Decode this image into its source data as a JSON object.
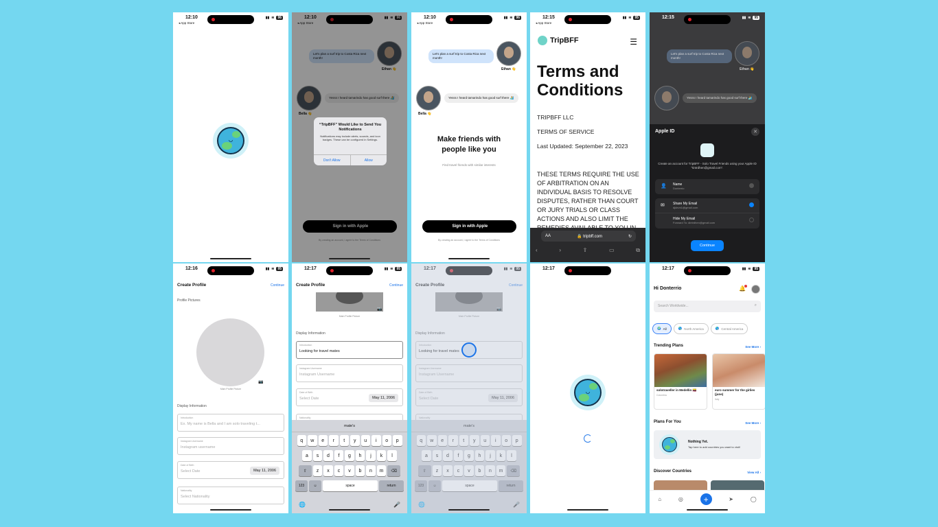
{
  "screens": {
    "splash": {
      "time": "12:10",
      "back": "◂ App Store",
      "battery": "96"
    },
    "notif": {
      "time": "12:10",
      "back": "◂ App Store",
      "battery": "96",
      "chat1": "Let's plan a surf trip to Costa Rica next month!",
      "name1": "Ethan 👋",
      "chat2": "Yesss I heard tamarindo has good surf there 🏄",
      "name2": "Bella 👋",
      "alert_title": "“TripBFF” Would Like to Send You Notifications",
      "alert_msg": "Notifications may include alerts, sounds, and icon badges. These can be configured in Settings.",
      "dont_allow": "Don't Allow",
      "allow": "Allow",
      "signin": "Sign in with Apple",
      "legal": "By creating an account, I agree to the Terms of Conditions"
    },
    "welcome": {
      "time": "12:10",
      "back": "◂ App Store",
      "battery": "96",
      "chat1": "Let's plan a surf trip to Costa Rica next month!",
      "name1": "Ethan 👋",
      "chat2": "Yesss I heard tamarindo has good surf there 🏄",
      "name2": "Bella 👋",
      "headline": "Make friends with people like you",
      "sub": "Find travel friends with similar interests",
      "signin": "Sign in with Apple",
      "legal": "By creating an account, I agree to the Terms of Conditions"
    },
    "terms": {
      "time": "12:15",
      "back": "◂ App Store",
      "battery": "95",
      "brand": "TripBFF",
      "title": "Terms and Conditions",
      "company": "TRIPBFF LLC",
      "tos": "TERMS OF SERVICE",
      "updated": "Last Updated: September 22, 2023",
      "caps": "THESE TERMS REQUIRE THE USE OF ARBITRATION ON AN INDIVIDUAL BASIS TO RESOLVE DISPUTES, RATHER THAN COURT OR JURY TRIALS OR CLASS ACTIONS AND ALSO LIMIT THE REMEDIES AVAILABLE TO YOU IN",
      "aa": "AA",
      "url": "🔒 tripbff.com",
      "reload": "↻"
    },
    "appleid": {
      "time": "12:15",
      "battery": "95",
      "chat1": "Let's plan a surf trip to Costa Rica next month!",
      "name1": "Ethan 👋",
      "chat2": "Yesss I heard tamarindo has good surf there 🏄",
      "sheet_title": "Apple ID",
      "close": "✕",
      "desc": "Create an account for TripBFF - Solo Travel Friends using your Apple ID “tintrdhen@gmail.com”.",
      "name_label": "Name",
      "name_value": "Donterrio",
      "share_label": "Share My Email",
      "share_value": "djdevn1@gmail.com",
      "hide_label": "Hide My Email",
      "hide_value": "Forward To: dintrdhen@gmail.com",
      "continue": "Continue"
    },
    "profile1": {
      "time": "12:16",
      "battery": "95",
      "title": "Create Profile",
      "continue": "Continue",
      "pics": "Profile Pictures",
      "main_pic": "Main Profile Picture",
      "display_info": "Display Information",
      "intro_label": "Introduction",
      "intro_ph": "Ex. My name is Bella and I am solo traveling t...",
      "ig_label": "Instagram Username",
      "ig_ph": "Instagram username",
      "dob_label": "Date of Birth",
      "dob_ph": "Select Date",
      "dob_val": "May 11, 2006",
      "nat_label": "Nationality",
      "nat_ph": "Select Nationality"
    },
    "profile2": {
      "time": "12:17",
      "battery": "95",
      "title": "Create Profile",
      "continue": "Continue",
      "main_pic": "Main Profile Picture",
      "display_info": "Display Information",
      "intro_label": "Introduction",
      "intro_val": "Looking for travel mates",
      "ig_label": "Instagram Username",
      "ig_ph": "Instagram Username",
      "dob_label": "Date of Birth",
      "dob_ph": "Select Date",
      "dob_val": "May 11, 2006",
      "nat_label": "Nationality",
      "suggestion": "mate's",
      "row1": [
        "q",
        "w",
        "e",
        "r",
        "t",
        "y",
        "u",
        "i",
        "o",
        "p"
      ],
      "row2": [
        "a",
        "s",
        "d",
        "f",
        "g",
        "h",
        "j",
        "k",
        "l"
      ],
      "row3": [
        "z",
        "x",
        "c",
        "v",
        "b",
        "n",
        "m"
      ],
      "shift": "⇧",
      "del": "⌫",
      "num": "123",
      "emoji": "☺",
      "space": "space",
      "return": "return",
      "globe": "🌐",
      "mic": "🎤"
    },
    "profile3": {
      "time": "12:17",
      "battery": "95",
      "title": "Create Profile",
      "continue": "Continue",
      "main_pic": "Main Profile Picture",
      "display_info": "Display Information",
      "intro_label": "Introduction",
      "intro_val": "Looking for travel mates",
      "ig_label": "Instagram Username",
      "ig_ph": "Instagram Username",
      "dob_label": "Date of Birth",
      "dob_ph": "Select Date",
      "dob_val": "May 11, 2006",
      "nat_label": "Nationality",
      "suggestion": "mate's",
      "row1": [
        "q",
        "w",
        "e",
        "r",
        "t",
        "y",
        "u",
        "i",
        "o",
        "p"
      ],
      "row2": [
        "a",
        "s",
        "d",
        "f",
        "g",
        "h",
        "j",
        "k",
        "l"
      ],
      "row3": [
        "z",
        "x",
        "c",
        "v",
        "b",
        "n",
        "m"
      ],
      "shift": "⇧",
      "del": "⌫",
      "num": "123",
      "emoji": "☺",
      "space": "space",
      "return": "return",
      "globe": "🌐",
      "mic": "🎤"
    },
    "loading": {
      "time": "12:17"
    },
    "home": {
      "time": "12:17",
      "battery": "95",
      "greeting": "Hi Donterrio",
      "search_ph": "Search Worldwide...",
      "chips": [
        "All",
        "North America",
        "Central America"
      ],
      "trending": "Trending Plans",
      "see_more": "See More ›",
      "card1_title": "solotraveller in Medellin 🇨🇴",
      "card1_meta": "Colombia",
      "card2_title": "euro summer for the girlies (june)",
      "card2_meta": "Italy",
      "plans_for_you": "Plans For You",
      "see_more2": "See More ›",
      "nothing": "Nothing Yet.",
      "nothing_sub": "Tap here to add countries you want to visit!",
      "discover": "Discover Countries",
      "view_all": "View All ›"
    }
  }
}
